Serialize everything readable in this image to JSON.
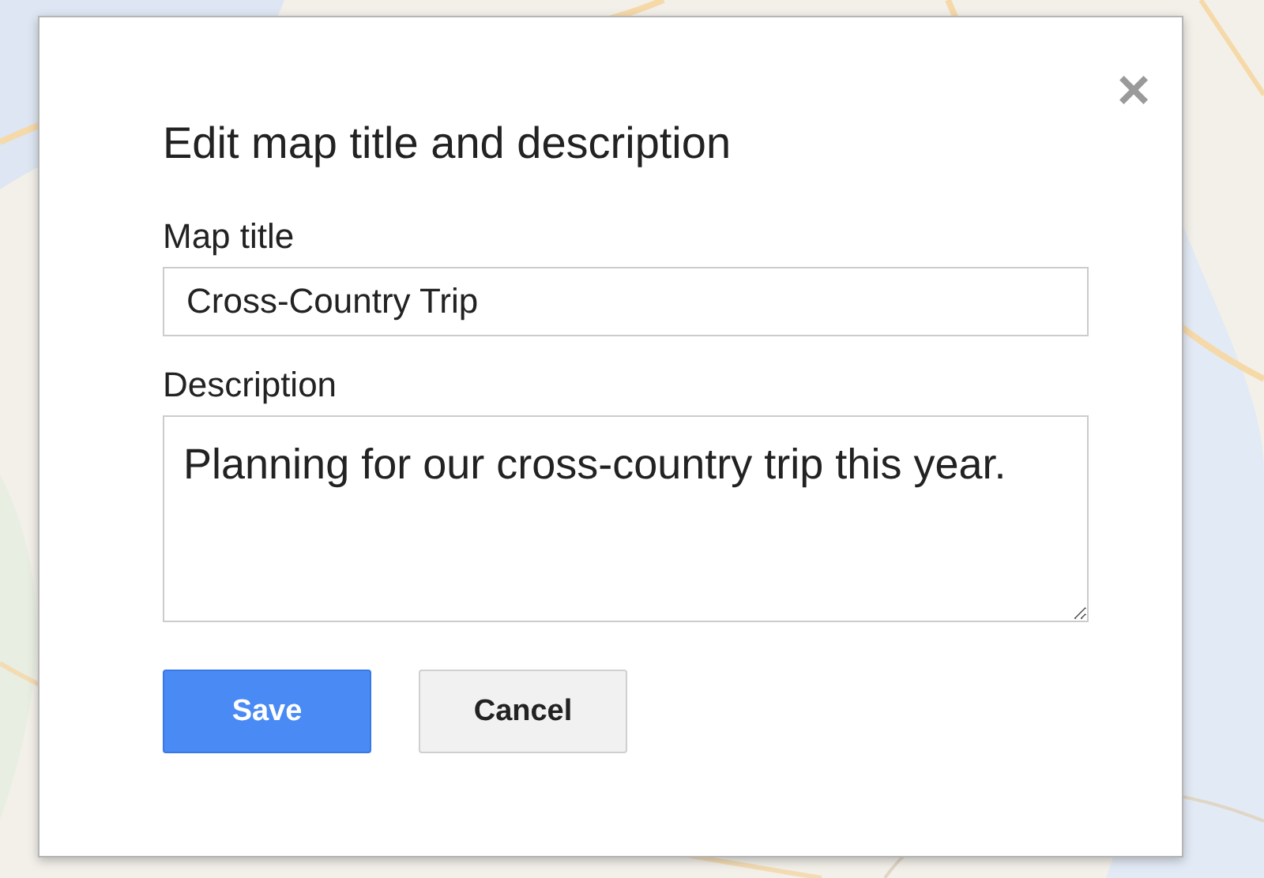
{
  "dialog": {
    "close": "×",
    "title": "Edit map title and description",
    "fields": [
      {
        "kind": "input",
        "label": "Map title",
        "value": "Cross-Country Trip"
      },
      {
        "kind": "textarea",
        "label": "Description",
        "value": "Planning for our cross-country trip this year."
      }
    ],
    "buttons": [
      {
        "kind": "primary",
        "label": "Save"
      },
      {
        "kind": "secondary",
        "label": "Cancel"
      }
    ]
  }
}
